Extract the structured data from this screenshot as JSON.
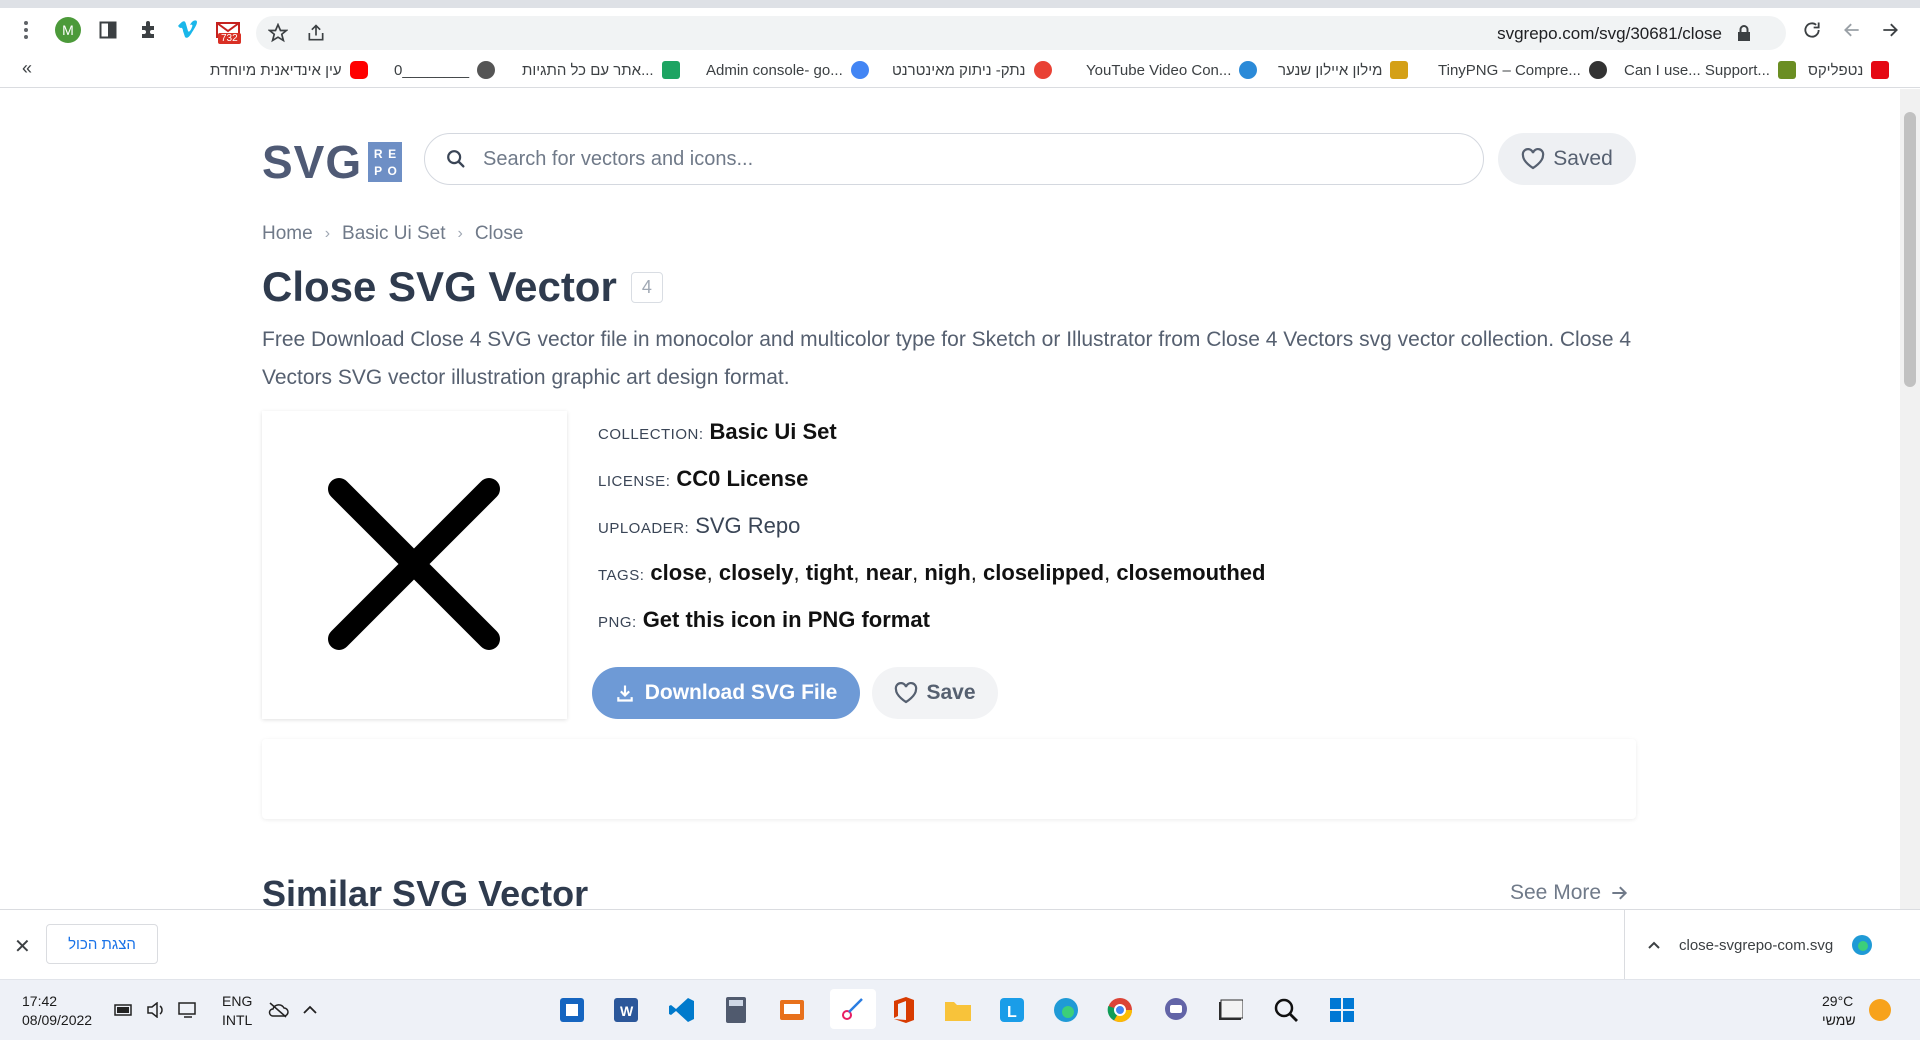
{
  "browser": {
    "url": "svgrepo.com/svg/30681/close",
    "profile_initial": "M",
    "gmail_badge": "732",
    "bookmarks_overflow": "«",
    "bookmarks": [
      {
        "label": "נטפליקס",
        "icon_color": "#e50914"
      },
      {
        "label": "Can I use... Support...",
        "icon_color": "#6b8e23"
      },
      {
        "label": "TinyPNG – Compre...",
        "icon_color": "#333333"
      },
      {
        "label": "מילון איילון שנער",
        "icon_color": "#d4a017"
      },
      {
        "label": "YouTube Video Con...",
        "icon_color": "#2b8ad8"
      },
      {
        "label": "נתק- ניתוק מאינטרנט",
        "icon_color": "#e94235"
      },
      {
        "label": "Admin console- go...",
        "icon_color": "#4285f4"
      },
      {
        "label": "אתר עם כל התגיות...",
        "icon_color": "#1da462"
      },
      {
        "label": "0________",
        "icon_color": "#555555"
      },
      {
        "label": "עין אינדיאנית מיוחדת",
        "icon_color": "#ff0000"
      }
    ]
  },
  "site": {
    "logo_text": "SVG",
    "logo_box": [
      "R",
      "E",
      "P",
      "O"
    ],
    "search_placeholder": "Search for vectors and icons...",
    "saved_label": "Saved"
  },
  "breadcrumb": [
    "Home",
    "Basic Ui Set",
    "Close"
  ],
  "page": {
    "title": "Close SVG Vector",
    "count": "4",
    "description": "Free Download Close 4 SVG vector file in monocolor and multicolor type for Sketch or Illustrator from Close 4 Vectors svg vector collection. Close 4 Vectors SVG vector illustration graphic art design format."
  },
  "meta": {
    "collection_label": "COLLECTION:",
    "collection_value": "Basic Ui Set",
    "license_label": "LICENSE:",
    "license_value": "CC0 License",
    "uploader_label": "UPLOADER:",
    "uploader_value": "SVG Repo",
    "tags_label": "TAGS:",
    "tags": [
      "close",
      "closely",
      "tight",
      "near",
      "nigh",
      "closelipped",
      "closemouthed"
    ],
    "png_label": "PNG:",
    "png_value": "Get this icon in PNG format"
  },
  "actions": {
    "download_label": "Download SVG File",
    "save_label": "Save"
  },
  "similar": {
    "heading": "Similar SVG Vector",
    "see_more": "See More"
  },
  "download_bar": {
    "show_all": "הצגת הכול",
    "file_name": "close-svgrepo-com.svg"
  },
  "taskbar": {
    "time": "17:42",
    "date": "08/09/2022",
    "lang_line1": "ENG",
    "lang_line2": "INTL",
    "temperature": "29°C",
    "weather": "שמשי"
  },
  "colors": {
    "accent_button": "#6e9ad6",
    "logo_text": "#4f5a75",
    "logo_box": "#6e8fc5"
  }
}
